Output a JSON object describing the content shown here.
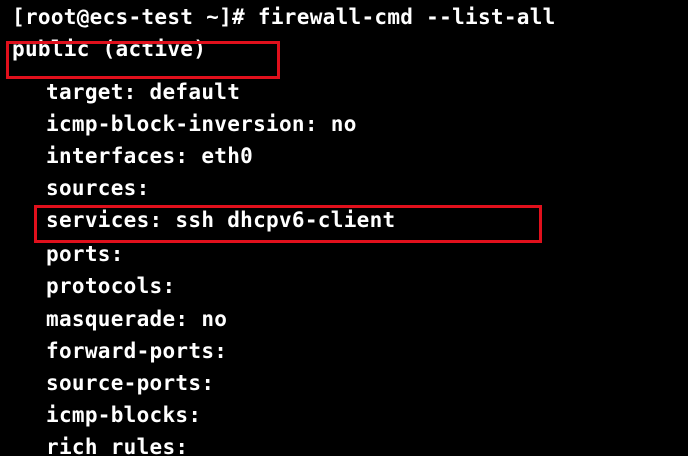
{
  "terminal": {
    "prompt_line": "[root@ecs-test ~]# firewall-cmd --list-all",
    "zone_line": "public (active)",
    "lines": [
      "target: default",
      "icmp-block-inversion: no",
      "interfaces: eth0",
      "sources:",
      "services: ssh dhcpv6-client",
      "ports:",
      "protocols:",
      "masquerade: no",
      "forward-ports:",
      "source-ports:",
      "icmp-blocks:",
      "rich rules:"
    ]
  },
  "annotations": {
    "highlight_color": "#e0101c",
    "highlighted": [
      "public (active)",
      "services: ssh dhcpv6-client"
    ]
  },
  "colors": {
    "background": "#000000",
    "text": "#ffffff"
  }
}
